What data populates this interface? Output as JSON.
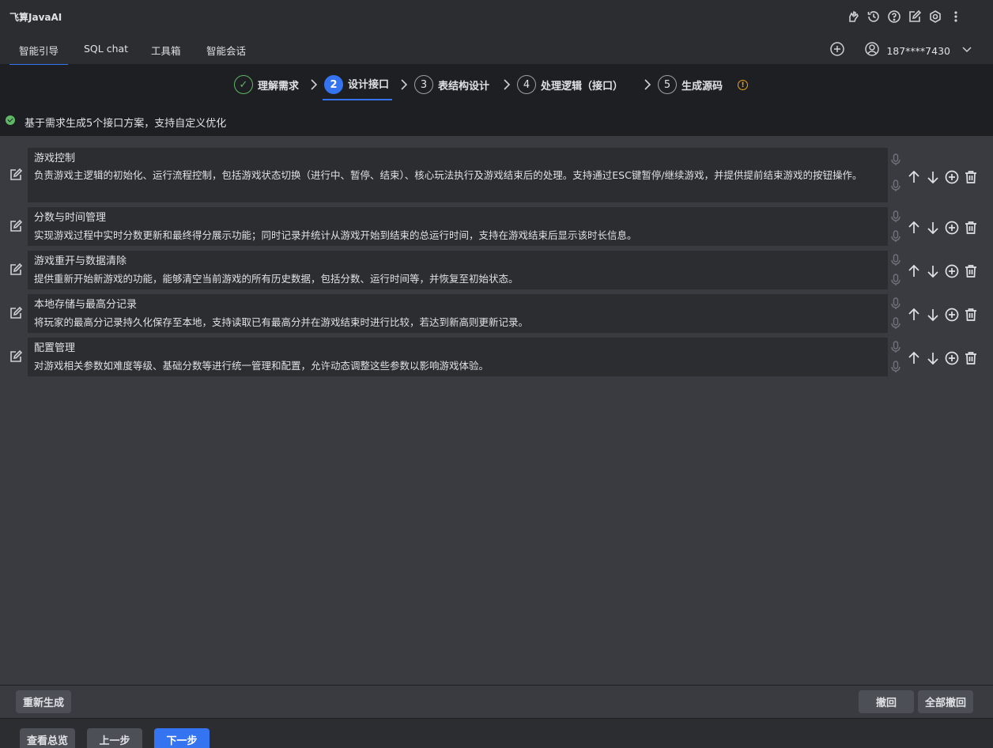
{
  "app": {
    "title": "飞算JavaAI"
  },
  "titlebar_icons": [
    "plugin-icon",
    "history-icon",
    "help-icon",
    "edit-icon",
    "settings-icon",
    "more-icon"
  ],
  "menu": {
    "tabs": [
      {
        "label": "智能引导",
        "active": true
      },
      {
        "label": "SQL chat",
        "active": false
      },
      {
        "label": "工具箱",
        "active": false
      },
      {
        "label": "智能会话",
        "active": false
      }
    ],
    "user": "187****7430"
  },
  "steps": [
    {
      "num": "✓",
      "label": "理解需求",
      "state": "done"
    },
    {
      "num": "2",
      "label": "设计接口",
      "state": "active"
    },
    {
      "num": "3",
      "label": "表结构设计",
      "state": "pending"
    },
    {
      "num": "4",
      "label": "处理逻辑（接口）",
      "state": "pending"
    },
    {
      "num": "5",
      "label": "生成源码",
      "state": "pending"
    }
  ],
  "info_glyph": "!",
  "notice": "基于需求生成5个接口方案，支持自定义优化",
  "interfaces": [
    {
      "title": "游戏控制",
      "desc": "负责游戏主逻辑的初始化、运行流程控制，包括游戏状态切换（进行中、暂停、结束）、核心玩法执行及游戏结束后的处理。支持通过ESC键暂停/继续游戏，并提供提前结束游戏的按钮操作。"
    },
    {
      "title": "分数与时间管理",
      "desc": "实现游戏过程中实时分数更新和最终得分展示功能；同时记录并统计从游戏开始到结束的总运行时间，支持在游戏结束后显示该时长信息。"
    },
    {
      "title": "游戏重开与数据清除",
      "desc": "提供重新开始新游戏的功能，能够清空当前游戏的所有历史数据，包括分数、运行时间等，并恢复至初始状态。"
    },
    {
      "title": "本地存储与最高分记录",
      "desc": "将玩家的最高分记录持久化保存至本地，支持读取已有最高分并在游戏结束时进行比较，若达到新高则更新记录。"
    },
    {
      "title": "配置管理",
      "desc": "对游戏相关参数如难度等级、基础分数等进行统一管理和配置，允许动态调整这些参数以影响游戏体验。"
    }
  ],
  "buttons": {
    "regenerate": "重新生成",
    "undo": "撤回",
    "undo_all": "全部撤回",
    "overview": "查看总览",
    "prev": "上一步",
    "next": "下一步"
  }
}
